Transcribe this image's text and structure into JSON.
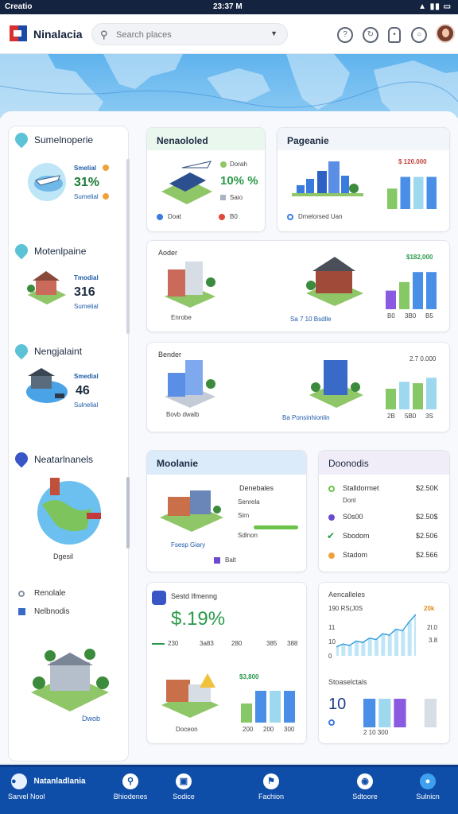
{
  "status_bar": {
    "left": "Creatio",
    "time": "23:37 M",
    "right": "▲ ▮▮ ▭"
  },
  "header": {
    "app_name": "Ninalacia",
    "search_placeholder": "Search places",
    "search_icon": "search-icon",
    "actions": [
      "help-icon",
      "history-icon",
      "lock-icon",
      "chat-icon"
    ]
  },
  "sidebar": {
    "sections": [
      {
        "title": "Sumelnoperie",
        "label_top": "Smelial",
        "value": "31%",
        "label_bottom": "Sumelial"
      },
      {
        "title": "Motenlpaine",
        "label_top": "Tmodial",
        "value": "316",
        "label_bottom": "Sumelial"
      },
      {
        "title": "Nengjalaint",
        "label_top": "Smedial",
        "value": "46",
        "label_bottom": "Sulnelial"
      }
    ],
    "nearby_title": "Neatarlnanels",
    "nearby_caption": "Dgesil",
    "links": [
      "Renolale",
      "Nelbnodis"
    ],
    "building_caption": "Dwob"
  },
  "cards": {
    "neneloled": {
      "title": "Nenaololed",
      "legend_top": "Dorah",
      "value": "10% %",
      "legend_mid": "Saio",
      "legend_left": "Doat",
      "legend_right": "B0"
    },
    "pageanie": {
      "title": "Pageanie",
      "value_label": "$ 120.000",
      "legend": "Dmelorsed Uan"
    },
    "row2": {
      "label": "Aoder",
      "value": "$182,000",
      "caption_left": "Enrobe",
      "caption_mid": "Sa 7 10 Bsdlle",
      "axis": [
        "B0",
        "3B0",
        "B5"
      ]
    },
    "row3": {
      "label": "Bender",
      "value": "2.7 0.000",
      "caption_left": "Bovb dwalb",
      "caption_mid": "Ba Ponsinhionlin",
      "axis": [
        "2B",
        "5B0",
        "3S"
      ]
    },
    "moolanie": {
      "title": "Moolanie",
      "items": [
        "Denebales",
        "Senrela",
        "Sirn",
        "Sdlnon"
      ],
      "button": "Balt",
      "caption": "Fsesp Giary"
    },
    "donodis": {
      "title": "Doonodis",
      "rows": [
        {
          "name": "Stalldormet",
          "sub": "Donl",
          "value": "$2.50K"
        },
        {
          "name": "S0s00",
          "value": "$2.50$"
        },
        {
          "name": "Sbodom",
          "value": "$2.506"
        },
        {
          "name": "Stadom",
          "value": "$2.566"
        }
      ]
    },
    "growth": {
      "title": "Sestd Ifmenng",
      "value": "$.19%",
      "axis": [
        "230",
        "3a83",
        "280",
        "385",
        "388"
      ],
      "chart_value": "$3,800",
      "axis2": [
        "200",
        "200",
        "300"
      ],
      "caption": "Doceon"
    },
    "activity": {
      "title": "Aencalleles",
      "line_label": "190 RS(J0S",
      "line_right": "20k",
      "y_axis": [
        "11",
        "10",
        "0"
      ],
      "right_axis": [
        "2l.0",
        "3.8"
      ],
      "stats_title": "Stoaselctals",
      "big_value": "10",
      "footer": "2 10 300"
    }
  },
  "chart_data": [
    {
      "type": "bar",
      "title": "Pageanie",
      "values": [
        28,
        44,
        44,
        44
      ],
      "ylim": [
        0,
        50
      ]
    },
    {
      "type": "bar",
      "title": "Aoder",
      "categories": [
        "B0",
        "3B0",
        "B5"
      ],
      "values": [
        26,
        38,
        52,
        52
      ],
      "ylim": [
        0,
        60
      ]
    },
    {
      "type": "bar",
      "title": "Bender",
      "categories": [
        "2B",
        "5B0",
        "3S"
      ],
      "values": [
        30,
        40,
        38,
        46
      ],
      "ylim": [
        0,
        60
      ]
    },
    {
      "type": "bar",
      "title": "Sestd Ifmenng",
      "categories": [
        "200",
        "200",
        "300"
      ],
      "values": [
        30,
        50,
        50,
        50
      ],
      "ylim": [
        0,
        60
      ]
    },
    {
      "type": "line",
      "title": "Aencalleles",
      "values": [
        12,
        16,
        14,
        20,
        18,
        24,
        22,
        30,
        28,
        36,
        34,
        46,
        56
      ]
    },
    {
      "type": "bar",
      "title": "Stoaselctals",
      "values": [
        36,
        36,
        36,
        10,
        36
      ],
      "ylim": [
        0,
        40
      ]
    }
  ],
  "bottom_nav": [
    {
      "label": "Sarvel Nool",
      "sub": "Natanladlania",
      "icon": "map-icon"
    },
    {
      "label": "Bhiodenes",
      "icon": "search-icon"
    },
    {
      "label": "Sodice",
      "icon": "photo-icon"
    },
    {
      "label": "Fachion",
      "icon": "flag-icon"
    },
    {
      "label": "Sdtoore",
      "icon": "camera-icon"
    },
    {
      "label": "Sulnicn",
      "icon": "notification-icon"
    }
  ],
  "colors": {
    "accent": "#0f4ea8",
    "bar_blue": "#4a8fe7",
    "bar_green": "#86c766",
    "bar_purple": "#8a5be0",
    "bar_teal": "#9ed8ef"
  }
}
